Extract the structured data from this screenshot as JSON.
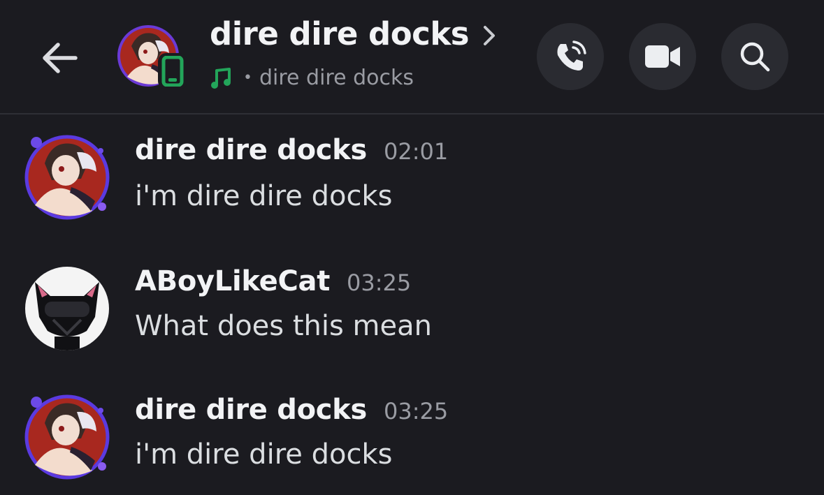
{
  "header": {
    "title": "dire dire docks",
    "activity": "dire dire docks",
    "separator": "•",
    "back_icon": "arrow-left-icon",
    "status_icon": "mobile-phone-icon",
    "activity_icon": "music-note-icon",
    "buttons": [
      {
        "icon": "phone-call-icon"
      },
      {
        "icon": "video-camera-icon"
      },
      {
        "icon": "search-icon"
      }
    ],
    "colors": {
      "background": "#1b1b20",
      "status_green": "#23a55a",
      "button_bg": "#2a2b31"
    }
  },
  "messages": [
    {
      "author": "dire dire docks",
      "time": "02:01",
      "text": "i'm dire dire docks"
    },
    {
      "author": "ABoyLikeCat",
      "time": "03:25",
      "text": "What does this mean"
    },
    {
      "author": "dire dire docks",
      "time": "03:25",
      "text": "i'm dire dire docks"
    }
  ]
}
